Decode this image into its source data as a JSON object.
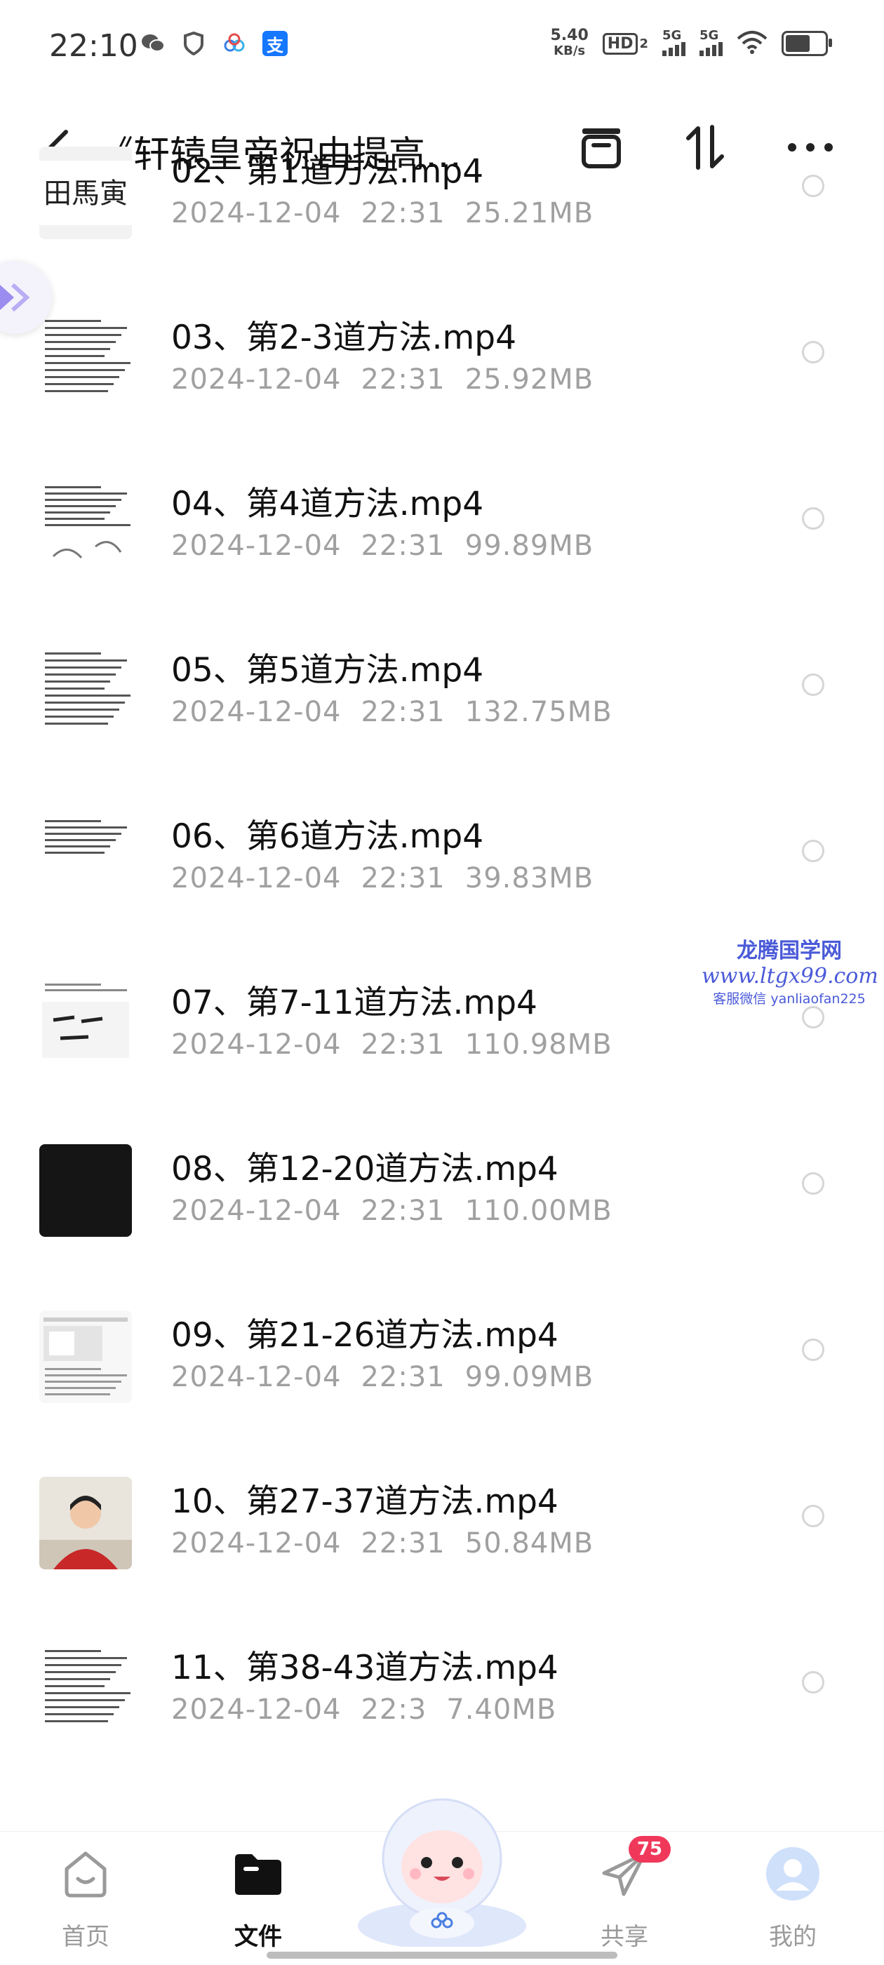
{
  "status_bar": {
    "time": "22:10",
    "net_speed_value": "5.40",
    "net_speed_unit": "KB/s",
    "hd_label": "HD",
    "hd_sub": "2",
    "sim1_label": "5G",
    "sim2_label": "5G",
    "left_icons": [
      "wechat-icon",
      "shield-icon",
      "cloud-drive-icon",
      "alipay-icon"
    ],
    "alipay_glyph": "支"
  },
  "header": {
    "title": "《轩辕皇帝祝由提高…"
  },
  "files": [
    {
      "name": "02、第1道方法.mp4",
      "date": "2024-12-04",
      "time": "22:31",
      "size": "25.21MB",
      "thumb": "calligraphy",
      "thumb_text": "田馬寅"
    },
    {
      "name": "03、第2-3道方法.mp4",
      "date": "2024-12-04",
      "time": "22:31",
      "size": "25.92MB",
      "thumb": "document"
    },
    {
      "name": "04、第4道方法.mp4",
      "date": "2024-12-04",
      "time": "22:31",
      "size": "99.89MB",
      "thumb": "document-sketch"
    },
    {
      "name": "05、第5道方法.mp4",
      "date": "2024-12-04",
      "time": "22:31",
      "size": "132.75MB",
      "thumb": "document"
    },
    {
      "name": "06、第6道方法.mp4",
      "date": "2024-12-04",
      "time": "22:31",
      "size": "39.83MB",
      "thumb": "document-short"
    },
    {
      "name": "07、第7-11道方法.mp4",
      "date": "2024-12-04",
      "time": "22:31",
      "size": "110.98MB",
      "thumb": "calligraphy-doc"
    },
    {
      "name": "08、第12-20道方法.mp4",
      "date": "2024-12-04",
      "time": "22:31",
      "size": "110.00MB",
      "thumb": "dark"
    },
    {
      "name": "09、第21-26道方法.mp4",
      "date": "2024-12-04",
      "time": "22:31",
      "size": "99.09MB",
      "thumb": "screen"
    },
    {
      "name": "10、第27-37道方法.mp4",
      "date": "2024-12-04",
      "time": "22:31",
      "size": "50.84MB",
      "thumb": "person"
    },
    {
      "name": "11、第38-43道方法.mp4",
      "date": "2024-12-04",
      "time": "22:3",
      "size": "7.40MB",
      "thumb": "document"
    }
  ],
  "watermark": {
    "line1": "龙腾国学网",
    "line2": "www.ltgx99.com",
    "line3": "客服微信 yanliaofan225"
  },
  "bottom_nav": {
    "items": [
      {
        "label": "首页",
        "icon": "home-icon",
        "active": false
      },
      {
        "label": "文件",
        "icon": "folder-icon",
        "active": true
      },
      {
        "label": "共享",
        "icon": "paper-plane-icon",
        "active": false,
        "badge": "75"
      },
      {
        "label": "我的",
        "icon": "profile-icon",
        "active": false
      }
    ]
  },
  "colors": {
    "text_primary": "#111111",
    "text_secondary": "#a0a0a0",
    "badge": "#f0385b",
    "accent": "#4a7fe0"
  }
}
